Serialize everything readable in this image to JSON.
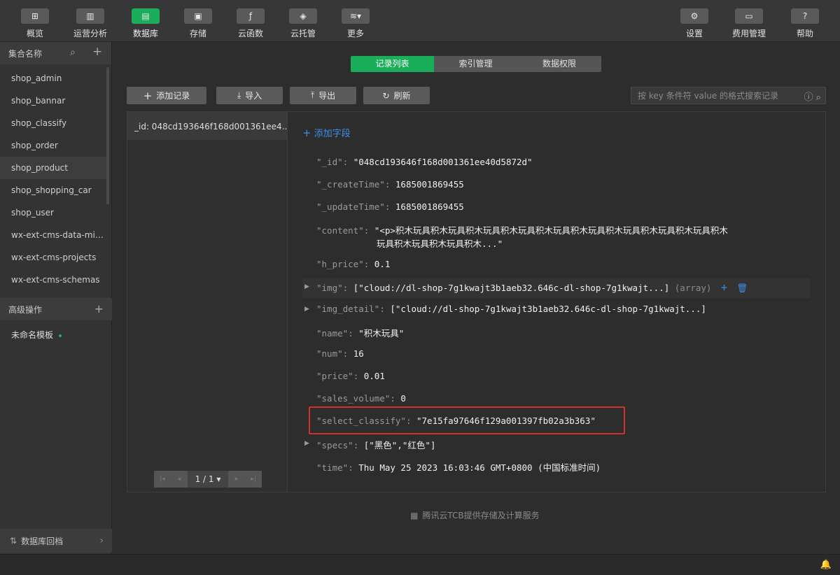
{
  "toolbar": {
    "left": [
      {
        "label": "概览",
        "icon": "grid-icon",
        "glyph": "⊞"
      },
      {
        "label": "运营分析",
        "icon": "bar-chart-icon",
        "glyph": "▥"
      },
      {
        "label": "数据库",
        "icon": "database-icon",
        "glyph": "▤"
      },
      {
        "label": "存储",
        "icon": "storage-icon",
        "glyph": "▣"
      },
      {
        "label": "云函数",
        "icon": "function-icon",
        "glyph": "ƒ"
      },
      {
        "label": "云托管",
        "icon": "cube-icon",
        "glyph": "◈"
      },
      {
        "label": "更多",
        "icon": "layers-icon",
        "glyph": "≋▾"
      }
    ],
    "right": [
      {
        "label": "设置",
        "icon": "gear-icon",
        "glyph": "⚙"
      },
      {
        "label": "费用管理",
        "icon": "billing-icon",
        "glyph": "▭"
      },
      {
        "label": "帮助",
        "icon": "help-icon",
        "glyph": "?"
      }
    ],
    "active_label": "数据库"
  },
  "sidebar": {
    "header": "集合名称",
    "collections": [
      "shop_admin",
      "shop_bannar",
      "shop_classify",
      "shop_order",
      "shop_product",
      "shop_shopping_car",
      "shop_user",
      "wx-ext-cms-data-mig...",
      "wx-ext-cms-projects",
      "wx-ext-cms-schemas"
    ],
    "selected": "shop_product",
    "advanced_header": "高级操作",
    "template_item": "未命名模板",
    "footer": "数据库回档"
  },
  "tabs": [
    "记录列表",
    "索引管理",
    "数据权限"
  ],
  "active_tab": "记录列表",
  "actions": {
    "add": "添加记录",
    "import": "导入",
    "export": "导出",
    "refresh": "刷新"
  },
  "search": {
    "placeholder": "按 key 条件符 value 的格式搜索记录"
  },
  "records": [
    "_id: 048cd193646f168d001361ee4..."
  ],
  "pager": {
    "text": "1 / 1 ▾"
  },
  "document": {
    "add_field": "添加字段",
    "fields": [
      {
        "key": "\"_id\"",
        "value": "\"048cd193646f168d001361ee40d5872d\""
      },
      {
        "key": "\"_createTime\"",
        "value": "1685001869455"
      },
      {
        "key": "\"_updateTime\"",
        "value": "1685001869455"
      },
      {
        "key": "\"content\"",
        "value": "\"<p>积木玩具积木玩具积木玩具积木玩具积木玩具积木玩具积木玩具积木玩具积木玩具积木",
        "value2": "玩具积木玩具积木玩具积木...\""
      },
      {
        "key": "\"h_price\"",
        "value": "0.1"
      },
      {
        "key": "\"img\"",
        "value": "[\"cloud://dl-shop-7g1kwajt3b1aeb32.646c-dl-shop-7g1kwajt...]",
        "type": "(array)"
      },
      {
        "key": "\"img_detail\"",
        "value": "[\"cloud://dl-shop-7g1kwajt3b1aeb32.646c-dl-shop-7g1kwajt...]"
      },
      {
        "key": "\"name\"",
        "value": "\"积木玩具\""
      },
      {
        "key": "\"num\"",
        "value": "16"
      },
      {
        "key": "\"price\"",
        "value": "0.01"
      },
      {
        "key": "\"sales_volume\"",
        "value": "0"
      },
      {
        "key": "\"select_classify\"",
        "value": "\"7e15fa97646f129a001397fb02a3b363\""
      },
      {
        "key": "\"specs\"",
        "value": "[\"黑色\",\"红色\"]"
      },
      {
        "key": "\"time\"",
        "value": "Thu May 25 2023 16:03:46 GMT+0800 (中国标准时间)"
      }
    ]
  },
  "footer_note": "腾讯云TCB提供存储及计算服务",
  "colors": {
    "accent": "#1aad5a",
    "link": "#3d8ee8",
    "highlight": "#d22f2f"
  }
}
